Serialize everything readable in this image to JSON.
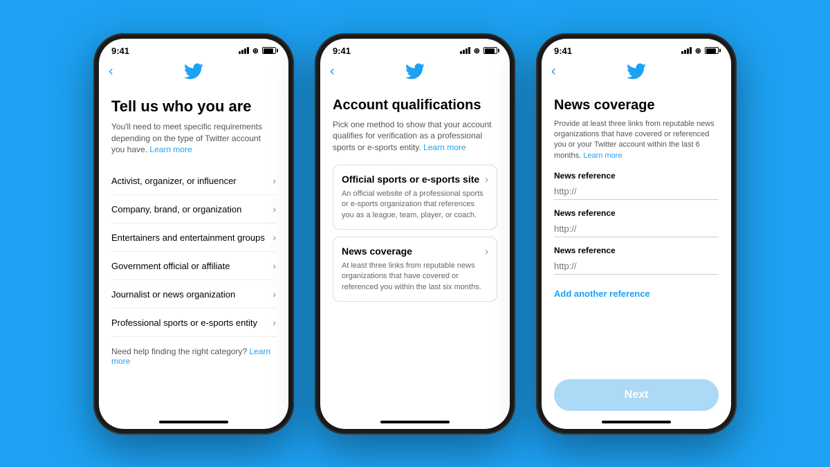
{
  "background_color": "#1da1f2",
  "phones": [
    {
      "id": "phone1",
      "status_bar": {
        "time": "9:41",
        "signal": true,
        "wifi": true,
        "battery": true
      },
      "nav": {
        "back_label": "‹",
        "twitter_logo": true
      },
      "screen": {
        "title": "Tell us who you are",
        "subtitle": "You'll need to meet specific requirements depending on the type of Twitter account you have.",
        "learn_link": "Learn more",
        "menu_items": [
          "Activist, organizer, or influencer",
          "Company, brand, or organization",
          "Entertainers and entertainment groups",
          "Government official or affiliate",
          "Journalist or news organization",
          "Professional sports or e-sports entity"
        ],
        "help_text": "Need help finding the right category?",
        "help_link": "Learn more"
      }
    },
    {
      "id": "phone2",
      "status_bar": {
        "time": "9:41",
        "signal": true,
        "wifi": true,
        "battery": true
      },
      "nav": {
        "back_label": "‹",
        "twitter_logo": true
      },
      "screen": {
        "title": "Account qualifications",
        "subtitle": "Pick one method to show that your account qualifies for verification as a professional sports or e-sports entity.",
        "learn_link": "Learn more",
        "cards": [
          {
            "title": "Official sports or e-sports site",
            "desc": "An official website of a professional sports or e-sports organization that references you as a league, team, player, or coach."
          },
          {
            "title": "News coverage",
            "desc": "At least three links from reputable news organizations that have covered or referenced you within the last six months."
          }
        ]
      }
    },
    {
      "id": "phone3",
      "status_bar": {
        "time": "9:41",
        "signal": true,
        "wifi": true,
        "battery": true
      },
      "nav": {
        "back_label": "‹",
        "twitter_logo": true
      },
      "screen": {
        "title": "News coverage",
        "subtitle": "Provide at least three links from reputable news organizations that have covered or referenced you or your Twitter account within the last 6 months.",
        "learn_link": "Learn more",
        "fields": [
          {
            "label": "News reference",
            "placeholder": "http://"
          },
          {
            "label": "News reference",
            "placeholder": "http://"
          },
          {
            "label": "News reference",
            "placeholder": "http://"
          }
        ],
        "add_reference": "Add another reference",
        "next_button": "Next"
      }
    }
  ]
}
